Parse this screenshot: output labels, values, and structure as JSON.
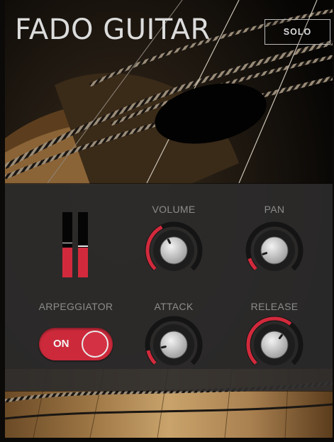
{
  "instrument": {
    "title": "FADO GUITAR",
    "solo_label": "SOLO"
  },
  "meters": {
    "left": {
      "level": 0.46,
      "peak": 0.52
    },
    "right": {
      "level": 0.46,
      "peak": 0.47
    }
  },
  "controls": {
    "volume": {
      "label": "VOLUME",
      "value": 0.4
    },
    "pan": {
      "label": "PAN",
      "value": 0.1
    },
    "attack": {
      "label": "ATTACK",
      "value": 0.12
    },
    "release": {
      "label": "RELEASE",
      "value": 0.64
    },
    "arpeggiator": {
      "label": "ARPEGGIATOR",
      "state": "ON"
    }
  },
  "colors": {
    "accent": "#d22a3c",
    "panel": "#2c2b2b",
    "label": "#8c8c8c",
    "title": "#dcdcdc"
  },
  "icons": {
    "knob": "rotary-knob-icon",
    "meter": "level-meter-icon",
    "toggle": "toggle-switch-icon"
  }
}
